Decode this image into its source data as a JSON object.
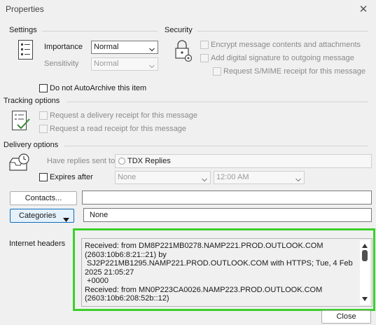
{
  "window": {
    "title": "Properties",
    "close_glyph": "✕"
  },
  "settings": {
    "label": "Settings",
    "importance_label": "Importance",
    "importance_value": "Normal",
    "sensitivity_label": "Sensitivity",
    "sensitivity_value": "Normal",
    "icon": "settings-list-icon"
  },
  "security": {
    "label": "Security",
    "icon": "lock-gear-icon",
    "encrypt_label": "Encrypt message contents and attachments",
    "signature_label": "Add digital signature to outgoing message",
    "smime_label": "Request S/MIME receipt for this message"
  },
  "autoarchive": {
    "label": "Do not AutoArchive this item"
  },
  "tracking": {
    "label": "Tracking options",
    "icon": "tracking-checklist-icon",
    "delivery_label": "Request a delivery receipt for this message",
    "read_label": "Request a read receipt for this message"
  },
  "delivery": {
    "label": "Delivery options",
    "icon": "inbox-clock-icon",
    "have_replies_label": "Have replies sent to",
    "replies_value": "TDX Replies",
    "expires_label": "Expires after",
    "expires_date": "None",
    "expires_time": "12:00 AM"
  },
  "contacts": {
    "button_label": "Contacts...",
    "value": ""
  },
  "categories": {
    "button_label": "Categories",
    "value": "None"
  },
  "internet_headers": {
    "label": "Internet headers",
    "lines": [
      "Received: from DM8P221MB0278.NAMP221.PROD.OUTLOOK.COM",
      "(2603:10b6:8:21::21) by",
      " SJ2P221MB1295.NAMP221.PROD.OUTLOOK.COM with HTTPS; Tue, 4 Feb",
      "2025 21:05:27",
      " +0000",
      "Received: from MN0P223CA0026.NAMP223.PROD.OUTLOOK.COM",
      "(2603:10b6:208:52b::12)"
    ]
  },
  "footer": {
    "close_label": "Close"
  },
  "colors": {
    "highlight": "#3dd02c",
    "primary_border": "#0f6cbd"
  }
}
